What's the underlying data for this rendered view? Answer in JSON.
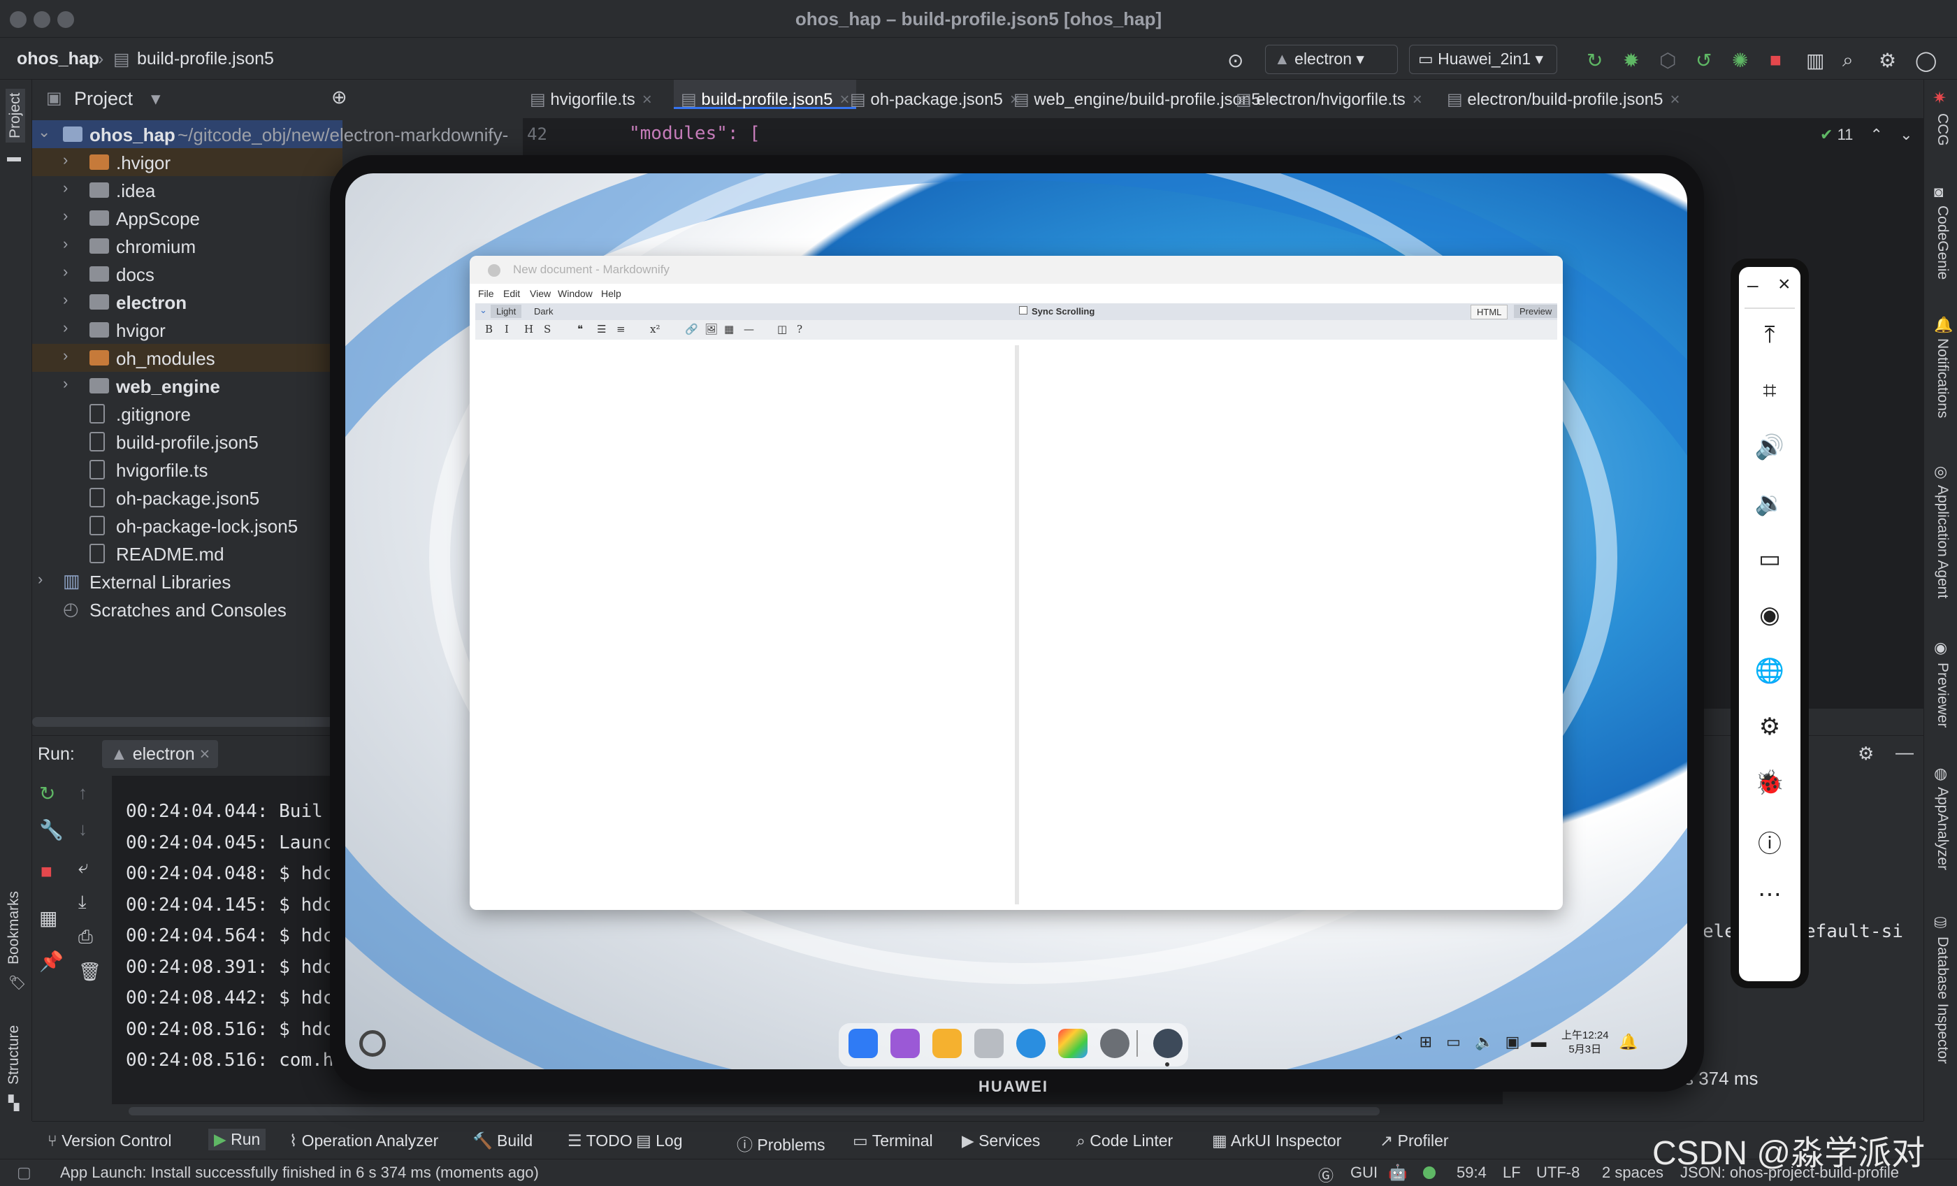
{
  "window": {
    "title": "ohos_hap – build-profile.json5 [ohos_hap]"
  },
  "nav": {
    "project": "ohos_hap",
    "file": "build-profile.json5",
    "run_config": "electron",
    "device": "Huawei_2in1"
  },
  "left_strip": {
    "project": "Project",
    "bookmarks": "Bookmarks",
    "structure": "Structure"
  },
  "right_strip": [
    "CCG",
    "CodeGenie",
    "Notifications",
    "Application Agent",
    "Previewer",
    "AppAnalyzer",
    "Database Inspector"
  ],
  "project_panel": {
    "title": "Project",
    "root": {
      "name": "ohos_hap",
      "path": "~/gitcode_obj/new/electron-markdownify-"
    },
    "items": [
      {
        "name": ".hvigor",
        "kind": "folder-orange",
        "expandable": true,
        "bold": false
      },
      {
        "name": ".idea",
        "kind": "folder",
        "expandable": true,
        "bold": false
      },
      {
        "name": "AppScope",
        "kind": "folder",
        "expandable": true,
        "bold": false
      },
      {
        "name": "chromium",
        "kind": "folder",
        "expandable": true,
        "bold": false
      },
      {
        "name": "docs",
        "kind": "folder",
        "expandable": true,
        "bold": false
      },
      {
        "name": "electron",
        "kind": "folder",
        "expandable": true,
        "bold": true
      },
      {
        "name": "hvigor",
        "kind": "folder",
        "expandable": true,
        "bold": false
      },
      {
        "name": "oh_modules",
        "kind": "folder-orange",
        "expandable": true,
        "bold": false
      },
      {
        "name": "web_engine",
        "kind": "folder",
        "expandable": true,
        "bold": true
      },
      {
        "name": ".gitignore",
        "kind": "file",
        "expandable": false,
        "bold": false
      },
      {
        "name": "build-profile.json5",
        "kind": "file",
        "expandable": false,
        "bold": false
      },
      {
        "name": "hvigorfile.ts",
        "kind": "file",
        "expandable": false,
        "bold": false
      },
      {
        "name": "oh-package.json5",
        "kind": "file",
        "expandable": false,
        "bold": false
      },
      {
        "name": "oh-package-lock.json5",
        "kind": "file",
        "expandable": false,
        "bold": false
      },
      {
        "name": "README.md",
        "kind": "file",
        "expandable": false,
        "bold": false
      }
    ],
    "external": "External Libraries",
    "scratches": "Scratches and Consoles"
  },
  "editor": {
    "tabs": [
      {
        "label": "hvigorfile.ts",
        "active": false
      },
      {
        "label": "build-profile.json5",
        "active": true
      },
      {
        "label": "oh-package.json5",
        "active": false
      },
      {
        "label": "web_engine/build-profile.json5",
        "active": false
      },
      {
        "label": "electron/hvigorfile.ts",
        "active": false
      },
      {
        "label": "electron/build-profile.json5",
        "active": false
      }
    ],
    "line_number": "42",
    "code": "\"modules\": [",
    "check_count": "11"
  },
  "run": {
    "label": "Run:",
    "tab": "electron",
    "lines": [
      "00:24:04.044: Buil",
      "00:24:04.045: Launc",
      "00:24:04.048: $ hdc",
      "00:24:04.145: $ hdc",
      "00:24:04.564: $ hdc",
      "00:24:08.391: $ hdc",
      "00:24:08.442: $ hdc",
      "00:24:08.516: $ hdc",
      "00:24:08.516: com.h"
    ],
    "right_frag1": "elec",
    "right_frag2": "efault-si",
    "right_frag3": "s 374 ms"
  },
  "bottom_tabs": [
    "Version Control",
    "Run",
    "Operation Analyzer",
    "Build",
    "TODO",
    "Log",
    "Problems",
    "Terminal",
    "Services",
    "Code Linter",
    "ArkUI Inspector",
    "Profiler"
  ],
  "status": {
    "message": "App Launch: Install successfully finished in 6 s 374 ms (moments ago)",
    "gui": "GUI",
    "position": "59:4",
    "line_sep": "LF",
    "encoding": "UTF-8",
    "indent": "2 spaces",
    "schema": "JSON: ohos-project-build-profile"
  },
  "device": {
    "brand": "HUAWEI",
    "clock_time": "上午12:24",
    "clock_date": "5月3日"
  },
  "markdownify": {
    "title": "New document - Markdownify",
    "menu": [
      "File",
      "Edit",
      "View",
      "Window",
      "Help"
    ],
    "theme_light": "Light",
    "theme_dark": "Dark",
    "sync": "Sync Scrolling",
    "html": "HTML",
    "preview": "Preview",
    "toolbar": [
      "B",
      "I",
      "H",
      "S",
      "❝",
      "☰",
      "≡",
      "x²",
      "🔗",
      "🖼",
      "▦",
      "—",
      "◫",
      "?"
    ]
  },
  "watermark": "CSDN @淼学派对"
}
